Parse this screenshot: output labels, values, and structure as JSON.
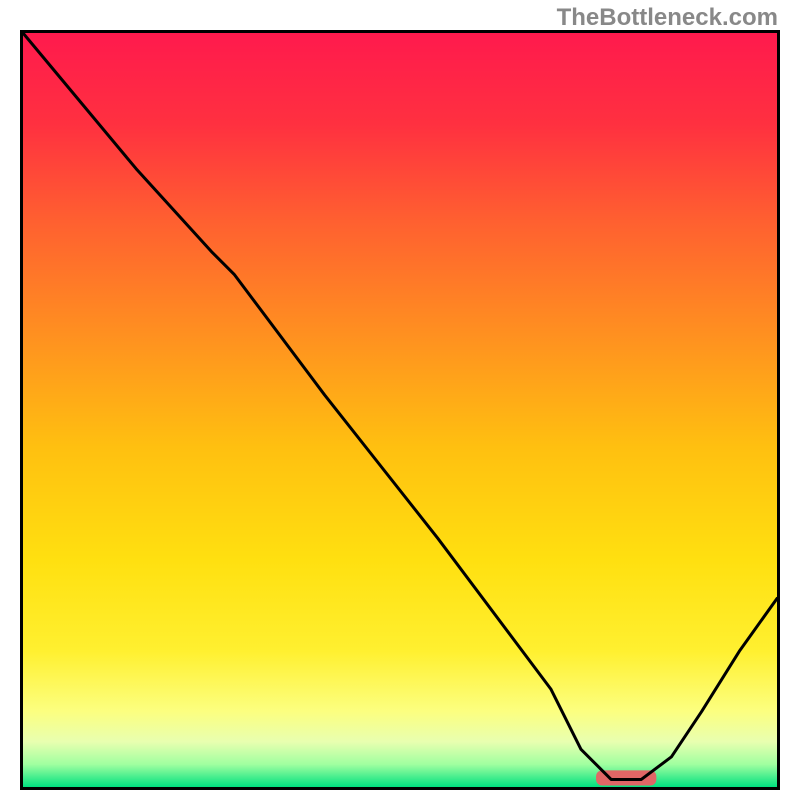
{
  "attribution": "TheBottleneck.com",
  "chart_data": {
    "type": "line",
    "title": "",
    "xlabel": "",
    "ylabel": "",
    "xlim": [
      0,
      100
    ],
    "ylim": [
      0,
      100
    ],
    "background_gradient": {
      "stops": [
        {
          "offset": 0.0,
          "color": "#ff1a4d"
        },
        {
          "offset": 0.12,
          "color": "#ff3040"
        },
        {
          "offset": 0.25,
          "color": "#ff6030"
        },
        {
          "offset": 0.4,
          "color": "#ff9020"
        },
        {
          "offset": 0.55,
          "color": "#ffc010"
        },
        {
          "offset": 0.7,
          "color": "#ffe010"
        },
        {
          "offset": 0.82,
          "color": "#fff030"
        },
        {
          "offset": 0.9,
          "color": "#fcff80"
        },
        {
          "offset": 0.94,
          "color": "#e8ffb0"
        },
        {
          "offset": 0.97,
          "color": "#a0ffa0"
        },
        {
          "offset": 1.0,
          "color": "#00e080"
        }
      ]
    },
    "series": [
      {
        "name": "bottleneck-curve",
        "x": [
          0,
          5,
          15,
          25,
          28,
          40,
          55,
          70,
          74,
          78,
          82,
          86,
          90,
          95,
          100
        ],
        "y": [
          100,
          94,
          82,
          71,
          68,
          52,
          33,
          13,
          5,
          1,
          1,
          4,
          10,
          18,
          25
        ]
      }
    ],
    "marker": {
      "name": "optimal-range",
      "x_start": 76,
      "x_end": 84,
      "y": 1
    }
  }
}
